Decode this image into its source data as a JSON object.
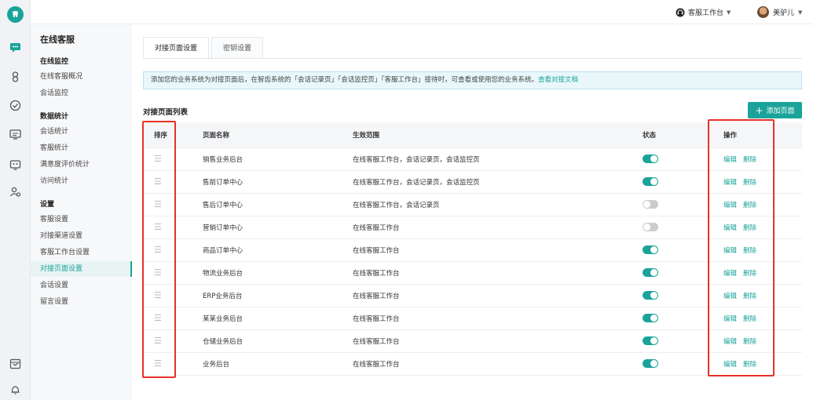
{
  "header": {
    "workbench_label": "客服工作台",
    "user_name": "美驴儿"
  },
  "sidebar": {
    "title": "在线客服",
    "groups": [
      {
        "label": "在线监控",
        "items": [
          "在线客服概况",
          "会话监控"
        ]
      },
      {
        "label": "数据统计",
        "items": [
          "会话统计",
          "客服统计",
          "满意度评价统计",
          "访问统计"
        ]
      },
      {
        "label": "设置",
        "items": [
          "客服设置",
          "对接渠道设置",
          "客服工作台设置",
          "对接页面设置",
          "会话设置",
          "留言设置"
        ]
      }
    ],
    "active_item": "对接页面设置"
  },
  "tabs": [
    {
      "label": "对接页面设置",
      "active": true
    },
    {
      "label": "密钥设置",
      "active": false
    }
  ],
  "info": {
    "text": "添加您的业务系统为对接页面后，在智齿系统的「会话记录页」「会话监控页」「客服工作台」接待时，可查看或使用您的业务系统。",
    "link": "查看对接文档"
  },
  "list": {
    "title": "对接页面列表",
    "add_button": "添加页面",
    "columns": [
      "排序",
      "页面名称",
      "生效范围",
      "状态",
      "操作"
    ],
    "edit_label": "编辑",
    "delete_label": "删除",
    "rows": [
      {
        "name": "销售业务后台",
        "scope": "在线客服工作台，会话记录页，会话监控页",
        "enabled": true
      },
      {
        "name": "售前订单中心",
        "scope": "在线客服工作台，会话记录页，会话监控页",
        "enabled": true
      },
      {
        "name": "售后订单中心",
        "scope": "在线客服工作台，会话记录页",
        "enabled": false
      },
      {
        "name": "营销订单中心",
        "scope": "在线客服工作台",
        "enabled": false
      },
      {
        "name": "商品订单中心",
        "scope": "在线客服工作台",
        "enabled": true
      },
      {
        "name": "物流业务后台",
        "scope": "在线客服工作台",
        "enabled": true
      },
      {
        "name": "ERP业务后台",
        "scope": "在线客服工作台",
        "enabled": true
      },
      {
        "name": "某某业务后台",
        "scope": "在线客服工作台",
        "enabled": true
      },
      {
        "name": "仓储业务后台",
        "scope": "在线客服工作台",
        "enabled": true
      },
      {
        "name": "业务后台",
        "scope": "在线客服工作台",
        "enabled": true
      }
    ]
  },
  "colors": {
    "accent": "#1aa39a",
    "highlight": "#e8302a"
  },
  "icons": [
    "logo-icon",
    "chat-icon",
    "customer-icon",
    "check-circle-icon",
    "monitor-chat-icon",
    "robot-icon",
    "users-icon",
    "calendar-icon",
    "bell-icon",
    "headset-icon",
    "drag-handle-icon",
    "plus-icon"
  ]
}
